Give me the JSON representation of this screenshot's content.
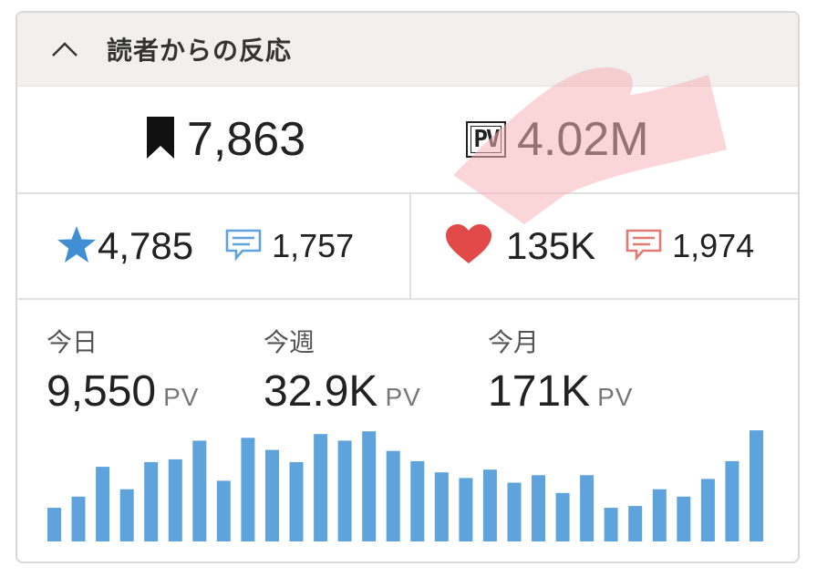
{
  "header": {
    "title": "読者からの反応",
    "toggle_icon": "chevron-up-icon"
  },
  "summary": {
    "bookmarks": {
      "icon": "bookmark-icon",
      "value": "7,863"
    },
    "pageviews": {
      "icon": "pv-badge-icon",
      "badge": "PV",
      "value": "4.02M"
    }
  },
  "reactions": {
    "stars": {
      "icon": "star-icon",
      "value": "4,785",
      "comment_icon": "comment-icon",
      "comments": "1,757"
    },
    "likes": {
      "icon": "heart-icon",
      "value": "135K",
      "comment_icon": "comment-icon",
      "comments": "1,974"
    }
  },
  "stats": [
    {
      "label": "今日",
      "value": "9,550",
      "unit": "PV"
    },
    {
      "label": "今週",
      "value": "32.9K",
      "unit": "PV"
    },
    {
      "label": "今月",
      "value": "171K",
      "unit": "PV"
    }
  ],
  "colors": {
    "bar": "#5fa3dc",
    "star": "#3f8fd2",
    "heart": "#e24a4a",
    "comment_blue": "#5fa3dc",
    "comment_red": "#e27a73",
    "highlight": "#f7b5b8"
  },
  "chart_data": {
    "type": "bar",
    "values": [
      36,
      48,
      80,
      56,
      85,
      88,
      108,
      65,
      111,
      98,
      85,
      115,
      108,
      118,
      97,
      86,
      74,
      68,
      77,
      63,
      71,
      52,
      71,
      36,
      38,
      56,
      48,
      67,
      86,
      119
    ],
    "ylim": [
      0,
      125
    ]
  }
}
